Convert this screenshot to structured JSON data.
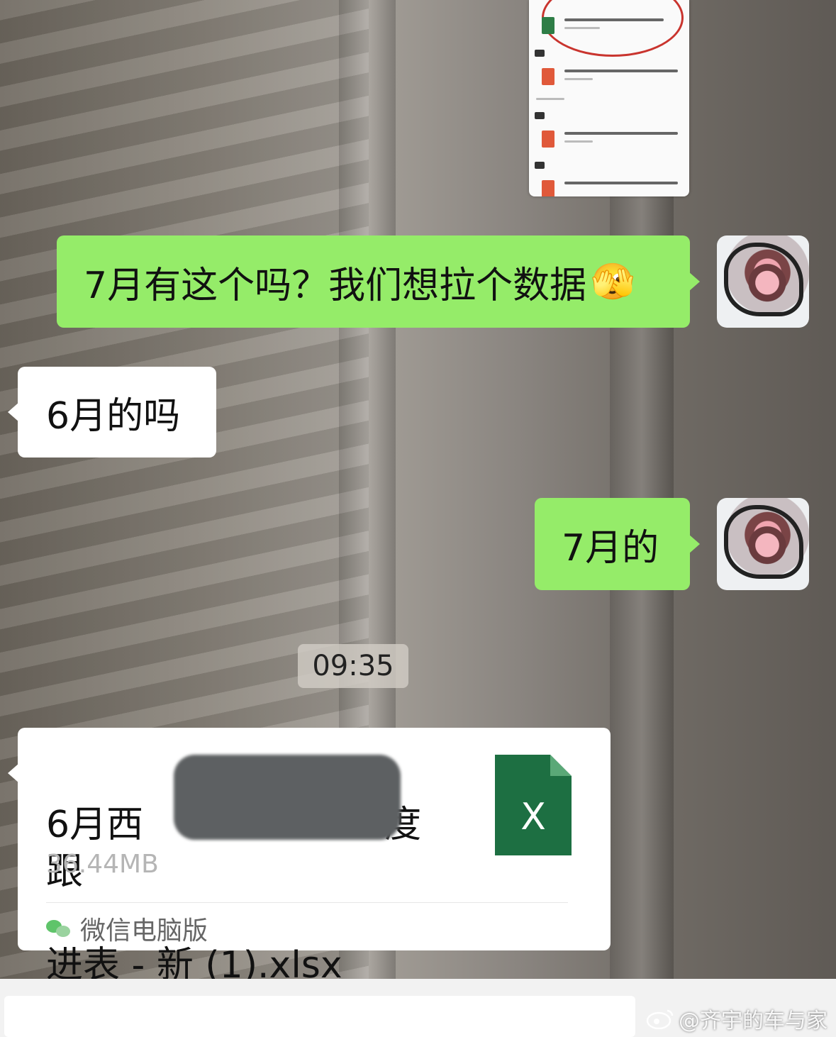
{
  "messages": {
    "m1": {
      "text": "7月有这个吗？我们想拉个数据",
      "emoji": "🫣"
    },
    "m2": {
      "text": "6月的吗"
    },
    "m3": {
      "text": "7月的"
    }
  },
  "timestamp": "09:35",
  "file": {
    "name_line1": "6月西",
    "name_line1_tail": "度跟",
    "name_line2": "进表 - 新 (1).xlsx",
    "size": "36.44MB",
    "source": "微信电脑版",
    "icon_letter": "X"
  },
  "watermark": "@齐宇的车与家",
  "colors": {
    "sent_bubble": "#95ec69",
    "received_bubble": "#ffffff",
    "excel_green": "#1d6f42"
  }
}
